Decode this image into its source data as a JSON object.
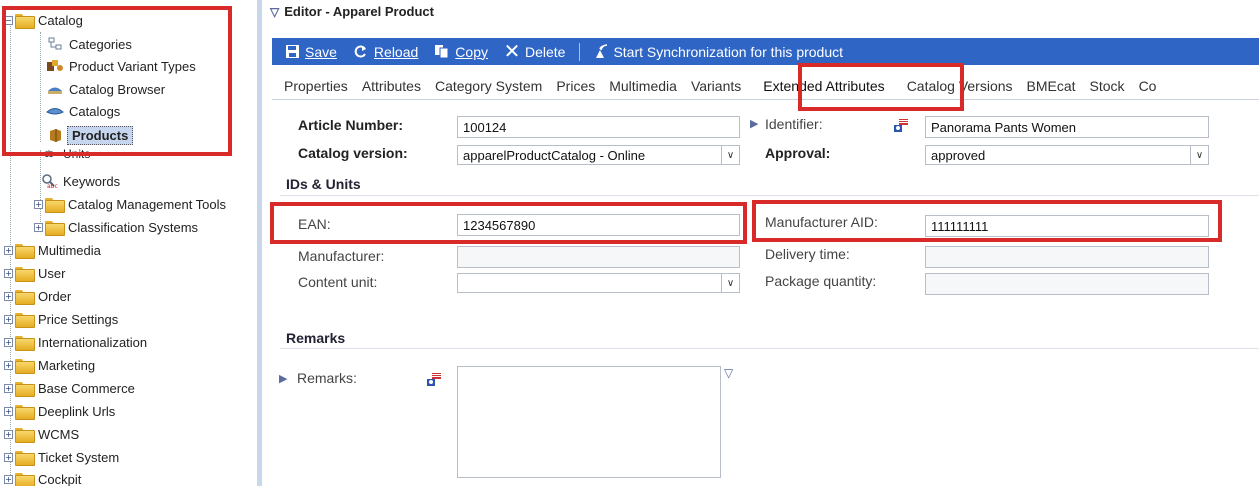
{
  "sidebar": {
    "catalog": "Catalog",
    "categories": "Categories",
    "product_variant_types": "Product Variant Types",
    "catalog_browser": "Catalog Browser",
    "catalogs": "Catalogs",
    "products": "Products",
    "units": "Units",
    "keywords": "Keywords",
    "catalog_management_tools": "Catalog Management Tools",
    "classification_systems": "Classification Systems",
    "top_level": [
      "Multimedia",
      "User",
      "Order",
      "Price Settings",
      "Internationalization",
      "Marketing",
      "Base Commerce",
      "Deeplink Urls",
      "WCMS",
      "Ticket System",
      "Cockpit"
    ]
  },
  "editor": {
    "title": "Editor - Apparel Product"
  },
  "toolbar": {
    "save": "Save",
    "reload": "Reload",
    "copy": "Copy",
    "delete": "Delete",
    "sync": "Start Synchronization for this product"
  },
  "tabs": [
    "Properties",
    "Attributes",
    "Category System",
    "Prices",
    "Multimedia",
    "Variants",
    "Extended Attributes",
    "Catalog Versions",
    "BMEcat",
    "Stock",
    "Co"
  ],
  "form": {
    "article_number_label": "Article Number:",
    "article_number": "100124",
    "identifier_label": "Identifier:",
    "identifier": "Panorama Pants Women",
    "catalog_version_label": "Catalog version:",
    "catalog_version": "apparelProductCatalog - Online",
    "approval_label": "Approval:",
    "approval": "approved",
    "ids_units_heading": "IDs & Units",
    "ean_label": "EAN:",
    "ean": "1234567890",
    "manufacturer_aid_label": "Manufacturer AID:",
    "manufacturer_aid": "111111111",
    "manufacturer_label": "Manufacturer:",
    "delivery_time_label": "Delivery time:",
    "content_unit_label": "Content unit:",
    "package_quantity_label": "Package quantity:",
    "remarks_heading": "Remarks",
    "remarks_label": "Remarks:"
  },
  "colors": {
    "toolbar": "#2f66c6",
    "highlight": "#d92a2a",
    "selected": "#c6d6ef"
  }
}
